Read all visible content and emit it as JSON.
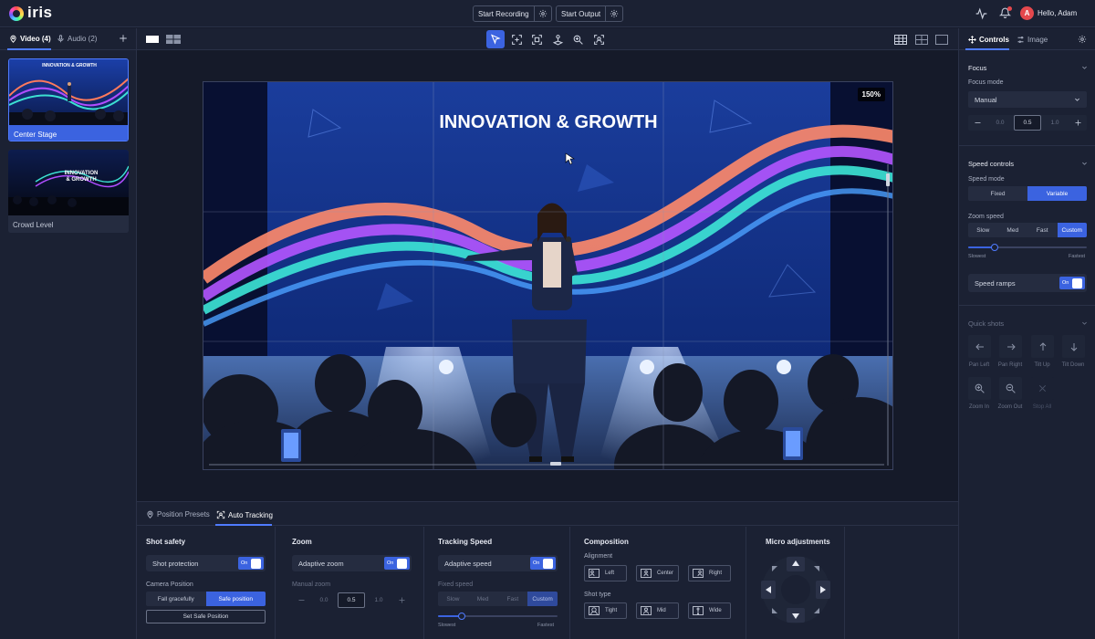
{
  "app": {
    "logo_text": "iris"
  },
  "topbar": {
    "start_recording": "Start Recording",
    "start_output": "Start Output",
    "user_initial": "A",
    "greeting": "Hello, Adam"
  },
  "left_panel": {
    "tabs": [
      {
        "label": "Video (4)"
      },
      {
        "label": "Audio (2)"
      }
    ],
    "sources": [
      {
        "label": "Center Stage",
        "selected": true
      },
      {
        "label": "Crowd Level",
        "selected": false
      }
    ],
    "thumb_text": [
      "INNOVATION & GROWTH",
      "INNOVATION",
      "& GROWTH"
    ]
  },
  "stage": {
    "slide_title": "INNOVATION & GROWTH",
    "zoom_level": "150%"
  },
  "bottom_panel": {
    "tabs": [
      {
        "label": "Position Presets"
      },
      {
        "label": "Auto Tracking"
      }
    ],
    "shot_safety": {
      "title": "Shot safety",
      "protection_label": "Shot protection",
      "toggle_on": "On",
      "camera_position": "Camera Position",
      "options": [
        "Fall gracefully",
        "Safe position"
      ],
      "set_button": "Set Safe Position"
    },
    "zoom": {
      "title": "Zoom",
      "adaptive_label": "Adaptive zoom",
      "toggle_on": "On",
      "manual_label": "Manual zoom",
      "min": "0.0",
      "value": "0.5",
      "max": "1.0"
    },
    "tracking_speed": {
      "title": "Tracking Speed",
      "adaptive_label": "Adaptive speed",
      "toggle_on": "On",
      "fixed_label": "Fixed speed",
      "options": [
        "Slow",
        "Med",
        "Fast",
        "Custom"
      ],
      "slowest": "Slowest",
      "fastest": "Fastest",
      "slider_value": 0.2
    },
    "composition": {
      "title": "Composition",
      "alignment_label": "Alignment",
      "alignment_options": [
        "Left",
        "Center",
        "Right"
      ],
      "shot_type_label": "Shot type",
      "shot_types": [
        "Tight",
        "Mid",
        "Wide"
      ]
    },
    "micro": {
      "title": "Micro adjustments"
    }
  },
  "right_panel": {
    "tabs": [
      {
        "label": "Controls"
      },
      {
        "label": "Image"
      }
    ],
    "focus": {
      "title": "Focus",
      "mode_label": "Focus mode",
      "mode_value": "Manual",
      "min": "0.0",
      "value": "0.5",
      "max": "1.0"
    },
    "speed": {
      "title": "Speed controls",
      "mode_label": "Speed mode",
      "modes": [
        "Fixed",
        "Variable"
      ],
      "zoom_speed_label": "Zoom speed",
      "zoom_options": [
        "Slow",
        "Med",
        "Fast",
        "Custom"
      ],
      "slowest": "Slowest",
      "fastest": "Fastest",
      "slider_value": 0.22,
      "ramps_label": "Speed ramps",
      "toggle_on": "On"
    },
    "quick_shots": {
      "title": "Quick shots",
      "items": [
        "Pan Left",
        "Pan Right",
        "Tilt Up",
        "Tilt Down",
        "Zoom In",
        "Zoom Out",
        "Stop All"
      ]
    }
  },
  "colors": {
    "accent": "#3b63e0",
    "background": "#161b2b",
    "panel": "#1b2133",
    "danger": "#e5484d"
  }
}
